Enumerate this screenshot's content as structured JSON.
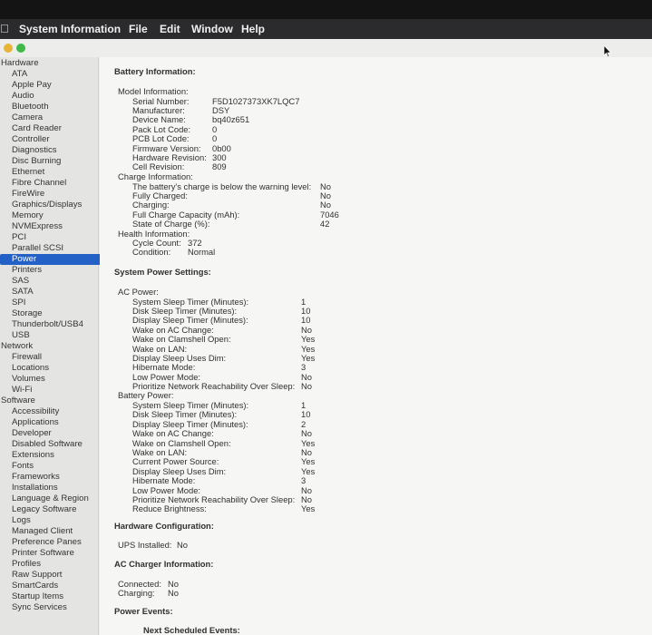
{
  "menubar": {
    "apple_icon": "apple-logo",
    "app_name": "System Information",
    "items": [
      "File",
      "Edit",
      "Window",
      "Help"
    ]
  },
  "sidebar": {
    "rows": [
      {
        "label": "Hardware",
        "kind": "category"
      },
      {
        "label": "ATA",
        "kind": "item"
      },
      {
        "label": "Apple Pay",
        "kind": "item"
      },
      {
        "label": "Audio",
        "kind": "item"
      },
      {
        "label": "Bluetooth",
        "kind": "item"
      },
      {
        "label": "Camera",
        "kind": "item"
      },
      {
        "label": "Card Reader",
        "kind": "item"
      },
      {
        "label": "Controller",
        "kind": "item"
      },
      {
        "label": "Diagnostics",
        "kind": "item"
      },
      {
        "label": "Disc Burning",
        "kind": "item"
      },
      {
        "label": "Ethernet",
        "kind": "item"
      },
      {
        "label": "Fibre Channel",
        "kind": "item"
      },
      {
        "label": "FireWire",
        "kind": "item"
      },
      {
        "label": "Graphics/Displays",
        "kind": "item"
      },
      {
        "label": "Memory",
        "kind": "item"
      },
      {
        "label": "NVMExpress",
        "kind": "item"
      },
      {
        "label": "PCI",
        "kind": "item"
      },
      {
        "label": "Parallel SCSI",
        "kind": "item"
      },
      {
        "label": "Power",
        "kind": "item",
        "selected": true
      },
      {
        "label": "Printers",
        "kind": "item"
      },
      {
        "label": "SAS",
        "kind": "item"
      },
      {
        "label": "SATA",
        "kind": "item"
      },
      {
        "label": "SPI",
        "kind": "item"
      },
      {
        "label": "Storage",
        "kind": "item"
      },
      {
        "label": "Thunderbolt/USB4",
        "kind": "item"
      },
      {
        "label": "USB",
        "kind": "item"
      },
      {
        "label": "Network",
        "kind": "category"
      },
      {
        "label": "Firewall",
        "kind": "item"
      },
      {
        "label": "Locations",
        "kind": "item"
      },
      {
        "label": "Volumes",
        "kind": "item"
      },
      {
        "label": "Wi-Fi",
        "kind": "item"
      },
      {
        "label": "Software",
        "kind": "category"
      },
      {
        "label": "Accessibility",
        "kind": "item"
      },
      {
        "label": "Applications",
        "kind": "item"
      },
      {
        "label": "Developer",
        "kind": "item"
      },
      {
        "label": "Disabled Software",
        "kind": "item"
      },
      {
        "label": "Extensions",
        "kind": "item"
      },
      {
        "label": "Fonts",
        "kind": "item"
      },
      {
        "label": "Frameworks",
        "kind": "item"
      },
      {
        "label": "Installations",
        "kind": "item"
      },
      {
        "label": "Language & Region",
        "kind": "item"
      },
      {
        "label": "Legacy Software",
        "kind": "item"
      },
      {
        "label": "Logs",
        "kind": "item"
      },
      {
        "label": "Managed Client",
        "kind": "item"
      },
      {
        "label": "Preference Panes",
        "kind": "item"
      },
      {
        "label": "Printer Software",
        "kind": "item"
      },
      {
        "label": "Profiles",
        "kind": "item"
      },
      {
        "label": "Raw Support",
        "kind": "item"
      },
      {
        "label": "SmartCards",
        "kind": "item"
      },
      {
        "label": "Startup Items",
        "kind": "item"
      },
      {
        "label": "Sync Services",
        "kind": "item"
      }
    ]
  },
  "content": {
    "battery_info": {
      "title": "Battery Information:",
      "model_info": {
        "label": "Model Information:",
        "rows": [
          {
            "k": "Serial Number:",
            "v": "F5D1027373XK7LQC7"
          },
          {
            "k": "Manufacturer:",
            "v": "DSY"
          },
          {
            "k": "Device Name:",
            "v": "bq40z651"
          },
          {
            "k": "Pack Lot Code:",
            "v": "0"
          },
          {
            "k": "PCB Lot Code:",
            "v": "0"
          },
          {
            "k": "Firmware Version:",
            "v": "0b00"
          },
          {
            "k": "Hardware Revision:",
            "v": "300"
          },
          {
            "k": "Cell Revision:",
            "v": "809"
          }
        ]
      },
      "charge_info": {
        "label": "Charge Information:",
        "rows": [
          {
            "k": "The battery's charge is below the warning level:",
            "v": "No"
          },
          {
            "k": "Fully Charged:",
            "v": "No"
          },
          {
            "k": "Charging:",
            "v": "No"
          },
          {
            "k": "Full Charge Capacity (mAh):",
            "v": "7046"
          },
          {
            "k": "State of Charge (%):",
            "v": "42"
          }
        ]
      },
      "health_info": {
        "label": "Health Information:",
        "rows": [
          {
            "k": "Cycle Count:",
            "v": "372"
          },
          {
            "k": "Condition:",
            "v": "Normal"
          }
        ]
      }
    },
    "power_settings": {
      "title": "System Power Settings:",
      "ac_power": {
        "label": "AC Power:",
        "rows": [
          {
            "k": "System Sleep Timer (Minutes):",
            "v": "1"
          },
          {
            "k": "Disk Sleep Timer (Minutes):",
            "v": "10"
          },
          {
            "k": "Display Sleep Timer (Minutes):",
            "v": "10"
          },
          {
            "k": "Wake on AC Change:",
            "v": "No"
          },
          {
            "k": "Wake on Clamshell Open:",
            "v": "Yes"
          },
          {
            "k": "Wake on LAN:",
            "v": "Yes"
          },
          {
            "k": "Display Sleep Uses Dim:",
            "v": "Yes"
          },
          {
            "k": "Hibernate Mode:",
            "v": "3"
          },
          {
            "k": "Low Power Mode:",
            "v": "No"
          },
          {
            "k": "Prioritize Network Reachability Over Sleep:",
            "v": "No"
          }
        ]
      },
      "battery_power": {
        "label": "Battery Power:",
        "rows": [
          {
            "k": "System Sleep Timer (Minutes):",
            "v": "1"
          },
          {
            "k": "Disk Sleep Timer (Minutes):",
            "v": "10"
          },
          {
            "k": "Display Sleep Timer (Minutes):",
            "v": "2"
          },
          {
            "k": "Wake on AC Change:",
            "v": "No"
          },
          {
            "k": "Wake on Clamshell Open:",
            "v": "Yes"
          },
          {
            "k": "Wake on LAN:",
            "v": "No"
          },
          {
            "k": "Current Power Source:",
            "v": "Yes"
          },
          {
            "k": "Display Sleep Uses Dim:",
            "v": "Yes"
          },
          {
            "k": "Hibernate Mode:",
            "v": "3"
          },
          {
            "k": "Low Power Mode:",
            "v": "No"
          },
          {
            "k": "Prioritize Network Reachability Over Sleep:",
            "v": "No"
          },
          {
            "k": "Reduce Brightness:",
            "v": "Yes"
          }
        ]
      }
    },
    "hardware_config": {
      "title": "Hardware Configuration:",
      "rows": [
        {
          "k": "UPS Installed:",
          "v": "No"
        }
      ]
    },
    "ac_charger": {
      "title": "AC Charger Information:",
      "rows": [
        {
          "k": "Connected:",
          "v": "No"
        },
        {
          "k": "Charging:",
          "v": "No"
        }
      ]
    },
    "power_events": {
      "title": "Power Events:",
      "next_scheduled": "Next Scheduled Events:"
    }
  }
}
